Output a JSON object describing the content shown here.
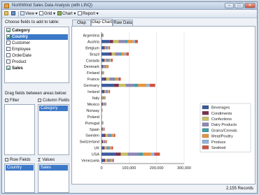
{
  "window": {
    "title": "NorthWind Sales Data Analysis (with LINQ)"
  },
  "toolbar": {
    "view_label": "View",
    "grid_label": "Grid",
    "chart_label": "Chart",
    "report_label": "Report"
  },
  "left": {
    "choose_label": "Choose fields to add to table:",
    "fields": [
      {
        "label": "Category",
        "checked": true,
        "bold": true,
        "selected": false
      },
      {
        "label": "Country",
        "checked": true,
        "bold": true,
        "selected": true
      },
      {
        "label": "Customer",
        "checked": false,
        "bold": false,
        "selected": false
      },
      {
        "label": "Employee",
        "checked": false,
        "bold": false,
        "selected": false
      },
      {
        "label": "OrderDate",
        "checked": false,
        "bold": false,
        "selected": false
      },
      {
        "label": "Product",
        "checked": false,
        "bold": false,
        "selected": false
      },
      {
        "label": "Sales",
        "checked": true,
        "bold": true,
        "selected": false
      }
    ],
    "drag_label": "Drag fields between areas below:",
    "filter_label": "Filter",
    "column_fields_label": "Column Fields",
    "column_items": [
      "Category"
    ],
    "row_fields_label": "Row Fields",
    "row_items": [
      "Country"
    ],
    "values_label": "Values",
    "value_items": [
      "Sales"
    ]
  },
  "tabs": [
    "Olap Grid",
    "Olap Chart",
    "Raw Data"
  ],
  "active_tab": 1,
  "status": {
    "records": "2,155 Records"
  },
  "chart_data": {
    "type": "bar",
    "orientation": "horizontal",
    "stacked": true,
    "categories": [
      "Argentina",
      "Austria",
      "Belgium",
      "Brazil",
      "Canada",
      "Denmark",
      "Finland",
      "France",
      "Germany",
      "Ireland",
      "Italy",
      "Mexico",
      "Norway",
      "Poland",
      "Portugal",
      "Spain",
      "Sweden",
      "Switzerland",
      "UK",
      "USA",
      "Venezuela"
    ],
    "xlim": [
      0,
      300000
    ],
    "xticks": [
      "0",
      "100,000",
      "200,000",
      "300,000"
    ],
    "grid": true,
    "legend_position": "right",
    "series": [
      {
        "name": "Beverages",
        "color": "#3a5a9c",
        "values": [
          1500,
          30000,
          9000,
          28000,
          7000,
          4000,
          1500,
          10000,
          45000,
          6000,
          1800,
          3000,
          800,
          300,
          800,
          1500,
          8000,
          2500,
          6000,
          50000,
          8000
        ]
      },
      {
        "name": "Condiments",
        "color": "#7a2f4f",
        "values": [
          1000,
          12000,
          3000,
          9000,
          4000,
          3000,
          1200,
          7000,
          18000,
          5000,
          1500,
          2000,
          400,
          300,
          1000,
          2500,
          6000,
          2500,
          5000,
          20000,
          5000
        ]
      },
      {
        "name": "Confections",
        "color": "#c8bf63",
        "values": [
          1200,
          20000,
          3000,
          12000,
          5000,
          3000,
          1500,
          12000,
          25000,
          4000,
          2500,
          3000,
          500,
          400,
          1200,
          2000,
          8000,
          4000,
          7000,
          25000,
          7000
        ]
      },
      {
        "name": "Dairy Products",
        "color": "#8e86b4",
        "values": [
          1500,
          25000,
          5000,
          18000,
          8000,
          4000,
          2000,
          14000,
          30000,
          5000,
          3000,
          3000,
          700,
          500,
          1500,
          2500,
          10000,
          4000,
          8000,
          40000,
          9000
        ]
      },
      {
        "name": "Grains/Cereals",
        "color": "#3f9fa6",
        "values": [
          600,
          7000,
          2000,
          6000,
          2500,
          2000,
          800,
          5000,
          15000,
          2000,
          1500,
          1500,
          300,
          200,
          600,
          1000,
          4000,
          1500,
          3000,
          15000,
          3000
        ]
      },
      {
        "name": "Meat/Poultry",
        "color": "#e6943c",
        "values": [
          800,
          20000,
          4000,
          10000,
          6000,
          4000,
          1000,
          9000,
          30000,
          4000,
          2000,
          2000,
          500,
          300,
          800,
          1200,
          6000,
          2000,
          5000,
          30000,
          5000
        ]
      },
      {
        "name": "Produce",
        "color": "#8fb3df",
        "values": [
          500,
          8000,
          2000,
          7000,
          3000,
          2000,
          500,
          5000,
          12000,
          2000,
          1000,
          1000,
          300,
          200,
          500,
          800,
          3000,
          1000,
          3000,
          12000,
          3000
        ]
      },
      {
        "name": "Seafood",
        "color": "#d0533f",
        "values": [
          700,
          10000,
          3000,
          9000,
          5000,
          3000,
          1000,
          8000,
          20000,
          3000,
          1500,
          2000,
          400,
          300,
          700,
          1000,
          5000,
          2000,
          5000,
          20000,
          5000
        ]
      }
    ]
  }
}
